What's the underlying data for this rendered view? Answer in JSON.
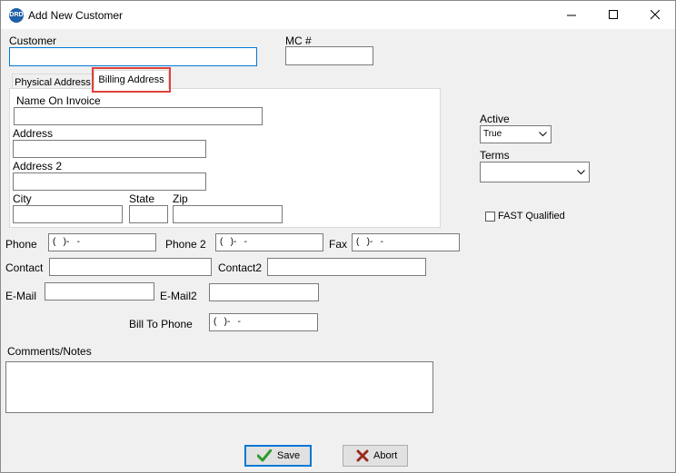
{
  "window": {
    "title": "Add New Customer",
    "icon_label": "DRD"
  },
  "form": {
    "customer_label": "Customer",
    "customer_value": "",
    "mc_label": "MC #",
    "mc_value": ""
  },
  "tabs": [
    {
      "label": "Physical Address",
      "active": false
    },
    {
      "label": "Billing Address",
      "active": true
    }
  ],
  "billing": {
    "name_on_invoice_label": "Name On Invoice",
    "address_label": "Address",
    "address2_label": "Address 2",
    "city_label": "City",
    "state_label": "State",
    "zip_label": "Zip"
  },
  "side": {
    "active_label": "Active",
    "active_value": "True",
    "terms_label": "Terms",
    "terms_value": "",
    "fast_label": "FAST Qualified",
    "fast_checked": false
  },
  "contact": {
    "phone_label": "Phone",
    "phone_mask": "(   )-   -",
    "phone2_label": "Phone 2",
    "phone2_mask": "(   )-   -",
    "fax_label": "Fax",
    "fax_mask": "(   )-   -",
    "contact_label": "Contact",
    "contact2_label": "Contact2",
    "email_label": "E-Mail",
    "email2_label": "E-Mail2",
    "bill_to_phone_label": "Bill To Phone",
    "bill_to_phone_mask": "(   )-   -"
  },
  "comments_label": "Comments/Notes",
  "buttons": {
    "save_label": "Save",
    "abort_label": "Abort"
  },
  "colors": {
    "focus_border": "#0078d7",
    "highlight": "#e0413a",
    "save_check": "#2e9a2e",
    "abort_x": "#9b2a1e"
  }
}
